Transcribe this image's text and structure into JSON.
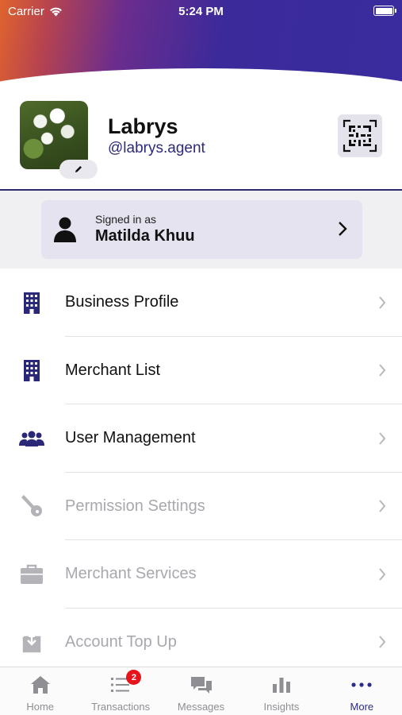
{
  "status_bar": {
    "carrier": "Carrier",
    "time": "5:24 PM"
  },
  "profile": {
    "name": "Labrys",
    "handle": "@labrys.agent"
  },
  "signed_in": {
    "label": "Signed in as",
    "name": "Matilda Khuu"
  },
  "menu": [
    {
      "label": "Business Profile",
      "icon": "building-icon",
      "enabled": true
    },
    {
      "label": "Merchant List",
      "icon": "building-icon",
      "enabled": true
    },
    {
      "label": "User Management",
      "icon": "users-icon",
      "enabled": true
    },
    {
      "label": "Permission Settings",
      "icon": "key-icon",
      "enabled": false
    },
    {
      "label": "Merchant Services",
      "icon": "briefcase-icon",
      "enabled": false
    },
    {
      "label": "Account Top Up",
      "icon": "download-box-icon",
      "enabled": false
    }
  ],
  "tabs": [
    {
      "label": "Home",
      "icon": "home-icon",
      "active": false
    },
    {
      "label": "Transactions",
      "icon": "list-icon",
      "active": false,
      "badge": "2"
    },
    {
      "label": "Messages",
      "icon": "chat-bubbles-icon",
      "active": false
    },
    {
      "label": "Insights",
      "icon": "bar-chart-icon",
      "active": false
    },
    {
      "label": "More",
      "icon": "more-dots-icon",
      "active": true
    }
  ],
  "colors": {
    "accent": "#2d2a8c",
    "icon_active": "#2b2878",
    "icon_disabled": "#b3b3b8",
    "badge": "#e8141b",
    "gradient_start": "#e0642d",
    "gradient_end": "#3a2c9e"
  }
}
